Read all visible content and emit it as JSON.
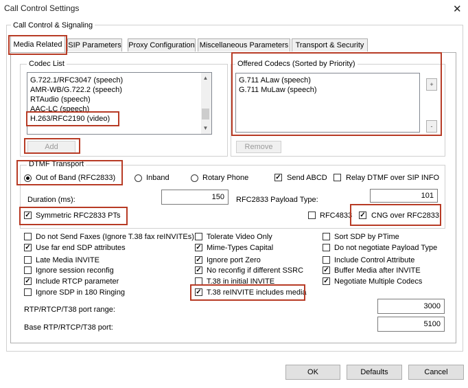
{
  "window": {
    "title": "Call Control Settings",
    "close_glyph": "✕"
  },
  "group_title": "Call Control & Signaling",
  "tabs": [
    {
      "label": "Media Related",
      "active": true
    },
    {
      "label": "SIP Parameters",
      "active": false
    },
    {
      "label": "Proxy Configuration",
      "active": false
    },
    {
      "label": "Miscellaneous Parameters",
      "active": false
    },
    {
      "label": "Transport & Security",
      "active": false
    }
  ],
  "codec_list": {
    "label": "Codec List",
    "items": [
      "G.722.1/RFC3047 (speech)",
      "AMR-WB/G.722.2 (speech)",
      "RTAudio (speech)",
      "AAC-LC (speech)",
      "H.263/RFC2190 (video)"
    ],
    "add_label": "Add"
  },
  "offered_codecs": {
    "label": "Offered Codecs (Sorted by Priority)",
    "items": [
      "G.711 ALaw (speech)",
      "G.711 MuLaw (speech)"
    ],
    "remove_label": "Remove",
    "up_glyph": "+",
    "down_glyph": "-"
  },
  "dtmf": {
    "label": "DTMF Transport",
    "radios": [
      {
        "label": "Out of Band (RFC2833)",
        "checked": true
      },
      {
        "label": "Inband",
        "checked": false
      },
      {
        "label": "Rotary Phone",
        "checked": false
      }
    ],
    "send_abcd": {
      "label": "Send ABCD",
      "checked": true
    },
    "relay_dtmf": {
      "label": "Relay DTMF over SIP INFO",
      "checked": false
    },
    "duration_label": "Duration (ms):",
    "duration_value": "150",
    "payload_label": "RFC2833 Payload Type:",
    "payload_value": "101",
    "symmetric": {
      "label": "Symmetric RFC2833 PTs",
      "checked": true
    },
    "rfc4833": {
      "label": "RFC4833",
      "checked": false
    },
    "cng": {
      "label": "CNG over RFC2833",
      "checked": true
    }
  },
  "options": {
    "col1": [
      {
        "label": "Do not Send Faxes (Ignore T.38 fax reINVITEs)",
        "checked": false
      },
      {
        "label": "Use far end SDP attributes",
        "checked": true
      },
      {
        "label": "Late Media INVITE",
        "checked": false
      },
      {
        "label": "Ignore session reconfig",
        "checked": false
      },
      {
        "label": "Include RTCP parameter",
        "checked": true
      },
      {
        "label": "Ignore SDP in 180 Ringing",
        "checked": false
      }
    ],
    "col2": [
      {
        "label": "Tolerate Video Only",
        "checked": false
      },
      {
        "label": "Mime-Types Capital",
        "checked": true
      },
      {
        "label": "Ignore port Zero",
        "checked": true
      },
      {
        "label": "No reconfig if different SSRC",
        "checked": true
      },
      {
        "label": "T.38 in initial INVITE",
        "checked": false
      },
      {
        "label": "T.38 reINVITE includes media",
        "checked": true
      }
    ],
    "col3": [
      {
        "label": "Sort SDP by PTime",
        "checked": false
      },
      {
        "label": "Do not negotiate Payload Type",
        "checked": false
      },
      {
        "label": "Include Control Attribute",
        "checked": false
      },
      {
        "label": "Buffer Media after INVITE",
        "checked": true
      },
      {
        "label": "Negotiate Multiple Codecs",
        "checked": true
      }
    ]
  },
  "ports": {
    "range_label": "RTP/RTCP/T38 port range:",
    "range_value": "3000",
    "base_label": "Base RTP/RTCP/T38 port:",
    "base_value": "5100"
  },
  "buttons": {
    "ok": "OK",
    "defaults": "Defaults",
    "cancel": "Cancel"
  },
  "colors": {
    "highlight": "#b73a24"
  }
}
